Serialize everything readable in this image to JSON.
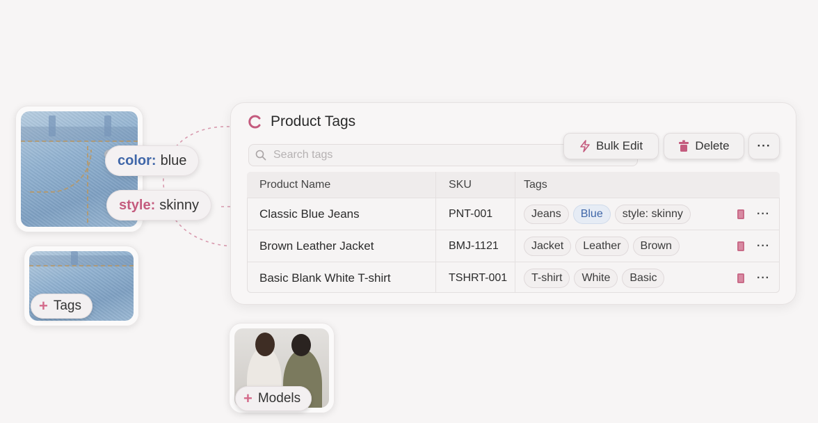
{
  "attributes": [
    {
      "key": "color",
      "sep": " :",
      "value": "blue"
    },
    {
      "key": "style",
      "sep": ":",
      "value": "skinny"
    }
  ],
  "add_tags_label": "Tags",
  "add_models_label": "Models",
  "panel": {
    "title": "Product Tags",
    "search_placeholder": "Search tags",
    "bulk_edit_label": "Bulk Edit",
    "delete_label": "Delete",
    "more_label": "···"
  },
  "table": {
    "columns": [
      "Product Name",
      "SKU",
      "Tags"
    ],
    "rows": [
      {
        "name": "Classic Blue Jeans",
        "sku": "PNT-001",
        "tags": [
          {
            "text": "Jeans",
            "highlight": false
          },
          {
            "text": "Blue",
            "highlight": true
          },
          {
            "text": "style: skinny",
            "highlight": false
          }
        ]
      },
      {
        "name": "Brown Leather Jacket",
        "sku": "BMJ-1121",
        "tags": [
          {
            "text": "Jacket",
            "highlight": false
          },
          {
            "text": "Leather",
            "highlight": false
          },
          {
            "text": "Brown",
            "highlight": false
          }
        ]
      },
      {
        "name": "Basic Blank White T-shirt",
        "sku": "TSHRT-001",
        "tags": [
          {
            "text": "T-shirt",
            "highlight": false
          },
          {
            "text": "White",
            "highlight": false
          },
          {
            "text": "Basic",
            "highlight": false
          }
        ]
      }
    ],
    "row_more_label": "···"
  },
  "colors": {
    "accent_pink": "#c45b7e",
    "accent_blue": "#3f66a8",
    "background": "#f7f5f5"
  },
  "icons": [
    "search-icon",
    "lightning-icon",
    "trash-icon",
    "more-dots-icon",
    "plus-icon",
    "logo-c-icon",
    "row-indicator-icon"
  ]
}
